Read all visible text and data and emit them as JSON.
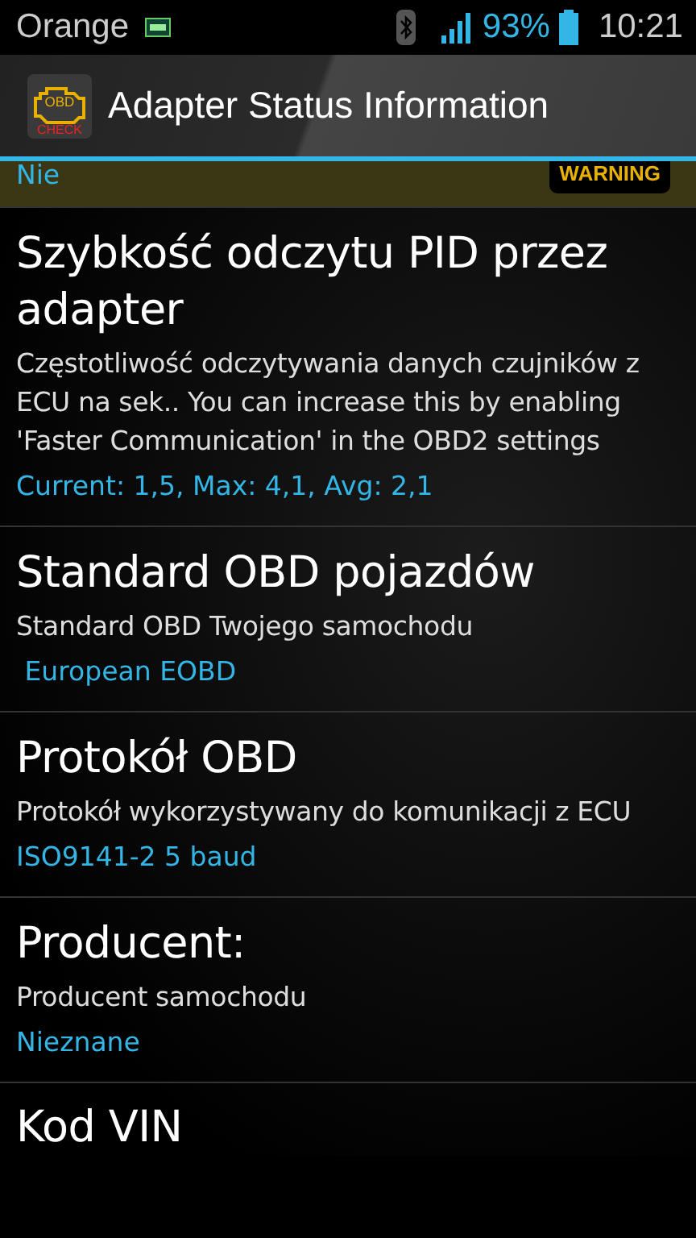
{
  "status_bar": {
    "carrier": "Orange",
    "battery_percent": "93%",
    "time": "10:21"
  },
  "action_bar": {
    "logo_top": "OBD",
    "logo_bottom": "CHECK",
    "title": "Adapter Status Information"
  },
  "items": [
    {
      "kind": "partial",
      "value": "Nie",
      "badge": "WARNING",
      "warning": true
    },
    {
      "kind": "full",
      "title": "Szybkość odczytu PID przez adapter",
      "description": "Częstotliwość odczytywania danych czujników z ECU na sek.. You can increase this by enabling 'Faster Communication' in the OBD2 settings",
      "value": "Current: 1,5, Max: 4,1, Avg: 2,1"
    },
    {
      "kind": "full",
      "title": "Standard OBD pojazdów",
      "description": "Standard OBD Twojego samochodu",
      "value": " European EOBD"
    },
    {
      "kind": "full",
      "title": "Protokół OBD",
      "description": "Protokół wykorzystywany do komunikacji z ECU",
      "value": "ISO9141-2 5 baud"
    },
    {
      "kind": "full",
      "title": "Producent:",
      "description": "Producent samochodu",
      "value": "Nieznane"
    },
    {
      "kind": "title_only",
      "title": "Kod VIN"
    }
  ]
}
